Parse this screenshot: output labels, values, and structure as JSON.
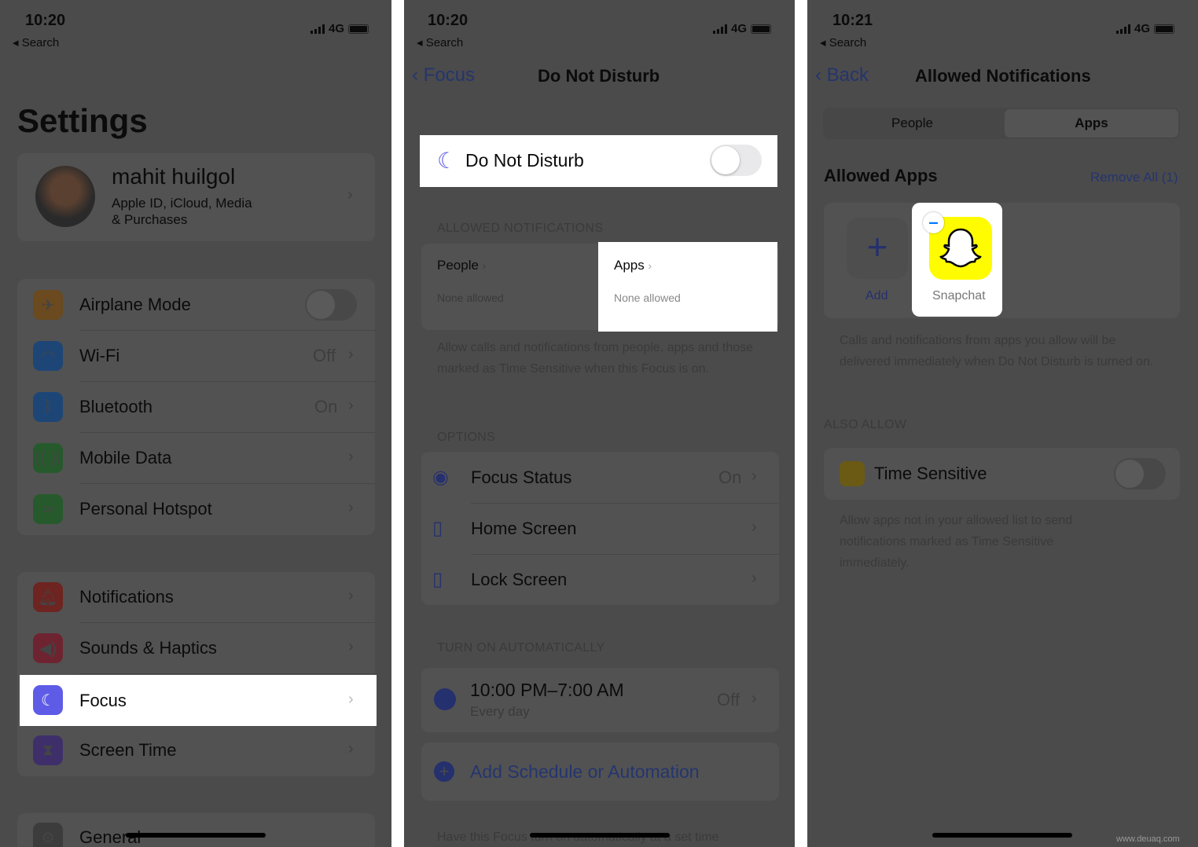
{
  "panel1": {
    "status": {
      "time": "10:20",
      "back": "◂ Search",
      "network": "4G"
    },
    "title": "Settings",
    "profile": {
      "name": "mahit huilgol",
      "subtitle1": "Apple ID, iCloud, Media",
      "subtitle2": "& Purchases"
    },
    "group1": [
      {
        "label": "Airplane Mode",
        "icon": "airplane-icon",
        "color": "#6a4a1e",
        "toggle": false
      },
      {
        "label": "Wi-Fi",
        "icon": "wifi-icon",
        "color": "#1d4677",
        "value": "Off"
      },
      {
        "label": "Bluetooth",
        "icon": "bluetooth-icon",
        "color": "#1d4677",
        "value": "On"
      },
      {
        "label": "Mobile Data",
        "icon": "antenna-icon",
        "color": "#265a2c"
      },
      {
        "label": "Personal Hotspot",
        "icon": "hotspot-icon",
        "color": "#265a2c"
      }
    ],
    "group2": [
      {
        "label": "Notifications",
        "icon": "bell-icon",
        "color": "#6e2420"
      },
      {
        "label": "Sounds & Haptics",
        "icon": "speaker-icon",
        "color": "#6e2430"
      },
      {
        "label": "Focus",
        "icon": "moon-icon",
        "color": "#5e5ce6",
        "highlighted": true
      },
      {
        "label": "Screen Time",
        "icon": "hourglass-icon",
        "color": "#3e2f6a"
      }
    ],
    "group3": [
      {
        "label": "General",
        "icon": "gear-icon"
      }
    ]
  },
  "panel2": {
    "status": {
      "time": "10:20",
      "back": "◂ Search",
      "network": "4G"
    },
    "nav": {
      "back": "Focus",
      "title": "Do Not Disturb"
    },
    "dnd": {
      "label": "Do Not Disturb",
      "toggle": false
    },
    "allowed_header": "ALLOWED NOTIFICATIONS",
    "people": {
      "label": "People",
      "sub": "None allowed"
    },
    "apps": {
      "label": "Apps",
      "sub": "None allowed"
    },
    "allowed_desc": "Allow calls and notifications from people, apps and those marked as Time Sensitive when this Focus is on.",
    "options_header": "OPTIONS",
    "options": [
      {
        "label": "Focus Status",
        "value": "On",
        "icon": "focus-status-icon"
      },
      {
        "label": "Home Screen",
        "icon": "home-screen-icon"
      },
      {
        "label": "Lock Screen",
        "icon": "lock-screen-icon"
      }
    ],
    "auto_header": "TURN ON AUTOMATICALLY",
    "schedule": {
      "time": "10:00 PM–7:00 AM",
      "sub": "Every day",
      "value": "Off"
    },
    "add_schedule": "Add Schedule or Automation",
    "footer": "Have this Focus turn on automatically at a set time"
  },
  "panel3": {
    "status": {
      "time": "10:21",
      "back": "◂ Search",
      "network": "4G"
    },
    "nav": {
      "back": "Back",
      "title": "Allowed Notifications"
    },
    "segments": [
      "People",
      "Apps"
    ],
    "selected_segment": "Apps",
    "allowed_apps": "Allowed Apps",
    "remove_all": "Remove All (1)",
    "add_label": "Add",
    "app": "Snapchat",
    "desc": "Calls and notifications from apps you allow will be delivered immediately when Do Not Disturb is turned on.",
    "also_allow": "ALSO ALLOW",
    "time_sensitive": {
      "label": "Time Sensitive",
      "toggle": false
    },
    "ts_desc": "Allow apps not in your allowed list to send notifications marked as Time Sensitive immediately."
  },
  "watermark": "www.deuaq.com",
  "colors": {
    "dim_bg": "#4b4b4b",
    "highlight": "#ffffff",
    "focus_purple": "#5e5ce6",
    "snap_yellow": "#fffc00",
    "ios_blue": "#007aff"
  }
}
